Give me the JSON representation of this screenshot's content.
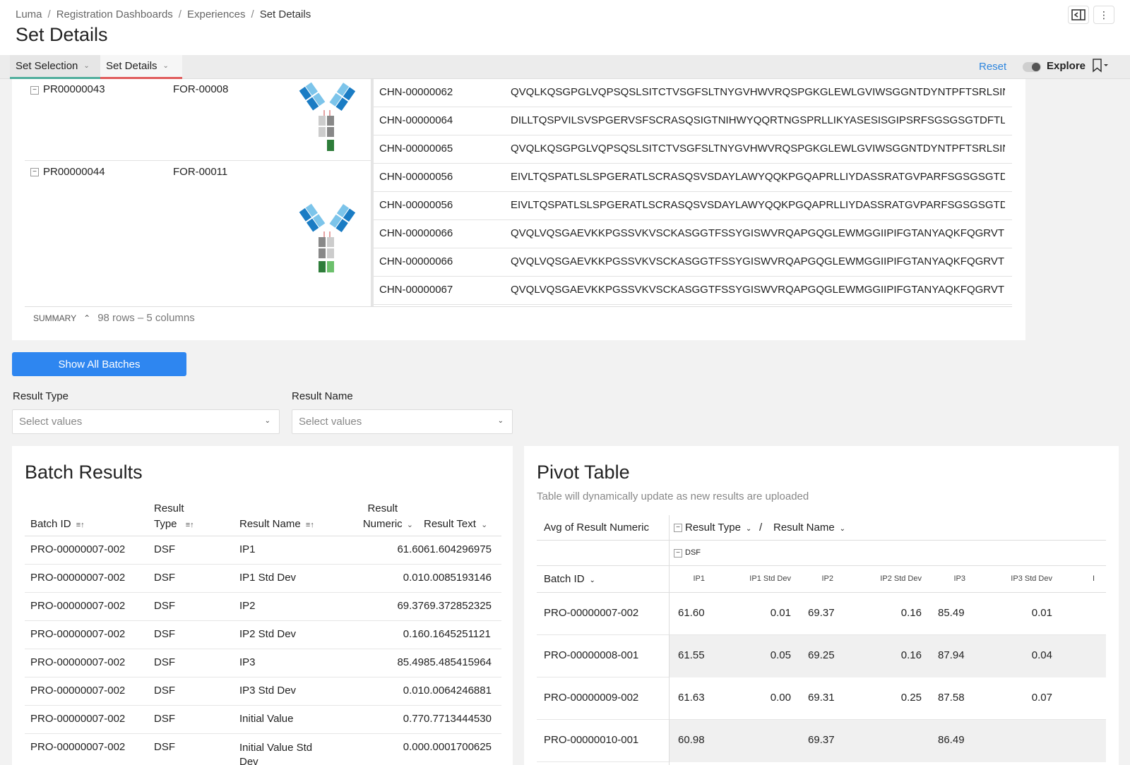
{
  "header": {
    "breadcrumb": [
      "Luma",
      "Registration Dashboards",
      "Experiences",
      "Set Details"
    ],
    "title": "Set Details"
  },
  "tabs": {
    "items": [
      {
        "label": "Set Selection"
      },
      {
        "label": "Set Details"
      }
    ],
    "reset_label": "Reset",
    "explore_label": "Explore"
  },
  "sets_table": {
    "groups": [
      {
        "protein_id": "PR00000043",
        "format": "FOR-00008"
      },
      {
        "protein_id": "PR00000044",
        "format": "FOR-00011"
      }
    ],
    "chains": [
      {
        "id": "CHN-00000062",
        "seq": "QVQLKQSGPGLVQPSQSLSITCTVSGFSLTNYGVHWVRQSPGKGLEWLGVIWSGGNTDYNTPFTSRLSINKD..."
      },
      {
        "id": "CHN-00000064",
        "seq": "DILLTQSPVILSVSPGERVSFSCRASQSIGTNIHWYQQRTNGSPRLLIKYASESISGIPSRFSGSGSGTDFTLSINSV..."
      },
      {
        "id": "CHN-00000065",
        "seq": "QVQLKQSGPGLVQPSQSLSITCTVSGFSLTNYGVHWVRQSPGKGLEWLGVIWSGGNTDYNTPFTSRLSINKD..."
      },
      {
        "id": "CHN-00000056",
        "seq": "EIVLTQSPATLSLSPGERATLSCRASQSVSDAYLAWYQQKPGQAPRLLIYDASSRATGVPARFSGSGSGTDFTLT..."
      },
      {
        "id": "CHN-00000056",
        "seq": "EIVLTQSPATLSLSPGERATLSCRASQSVSDAYLAWYQQKPGQAPRLLIYDASSRATGVPARFSGSGSGTDFTLT..."
      },
      {
        "id": "CHN-00000066",
        "seq": "QVQLVQSGAEVKKPGSSVKVSCKASGGTFSSYGISWVRQAPGQGLEWMGGIIPIFGTANYAQKFQGRVTITAD..."
      },
      {
        "id": "CHN-00000066",
        "seq": "QVQLVQSGAEVKKPGSSVKVSCKASGGTFSSYGISWVRQAPGQGLEWMGGIIPIFGTANYAQKFQGRVTITAD..."
      },
      {
        "id": "CHN-00000067",
        "seq": "QVQLVQSGAEVKKPGSSVKVSCKASGGTFSSYGISWVRQAPGQGLEWMGGIIPIFGTANYAQKFQGRVTITAD..."
      }
    ],
    "summary_label": "SUMMARY",
    "summary_rows": "98 rows – 5 columns"
  },
  "show_all_button": "Show All Batches",
  "filters": {
    "result_type": {
      "label": "Result Type",
      "placeholder": "Select values"
    },
    "result_name": {
      "label": "Result Name",
      "placeholder": "Select values"
    }
  },
  "batch_results": {
    "title": "Batch Results",
    "columns": {
      "batch_id": "Batch ID",
      "result_type_1": "Result",
      "result_type_2": "Type",
      "result_name": "Result Name",
      "result_numeric_1": "Result",
      "result_numeric_2": "Numeric",
      "result_text": "Result Text"
    },
    "rows": [
      {
        "bid": "PRO-00000007-002",
        "rt": "DSF",
        "rn": "IP1",
        "num": "61.60",
        "txt": "61.604296975"
      },
      {
        "bid": "PRO-00000007-002",
        "rt": "DSF",
        "rn": "IP1 Std Dev",
        "num": "0.01",
        "txt": "0.0085193146"
      },
      {
        "bid": "PRO-00000007-002",
        "rt": "DSF",
        "rn": "IP2",
        "num": "69.37",
        "txt": "69.372852325"
      },
      {
        "bid": "PRO-00000007-002",
        "rt": "DSF",
        "rn": "IP2 Std Dev",
        "num": "0.16",
        "txt": "0.1645251121"
      },
      {
        "bid": "PRO-00000007-002",
        "rt": "DSF",
        "rn": "IP3",
        "num": "85.49",
        "txt": "85.485415964"
      },
      {
        "bid": "PRO-00000007-002",
        "rt": "DSF",
        "rn": "IP3 Std Dev",
        "num": "0.01",
        "txt": "0.0064246881"
      },
      {
        "bid": "PRO-00000007-002",
        "rt": "DSF",
        "rn": "Initial Value",
        "num": "0.77",
        "txt": "0.7713444530"
      },
      {
        "bid": "PRO-00000007-002",
        "rt": "DSF",
        "rn": "Initial Value Std Dev",
        "num": "0.00",
        "txt": "0.0001700625"
      }
    ]
  },
  "pivot": {
    "title": "Pivot Table",
    "subtitle": "Table will dynamically update as new results are uploaded",
    "measure": "Avg of Result Numeric",
    "col_dim1": "Result Type",
    "col_sep": "/",
    "col_dim2": "Result Name",
    "group": "DSF",
    "row_dim": "Batch ID",
    "columns": [
      "IP1",
      "IP1 Std Dev",
      "IP2",
      "IP2 Std Dev",
      "IP3",
      "IP3 Std Dev",
      "I"
    ],
    "rows": [
      {
        "bid": "PRO-00000007-002",
        "v": [
          "61.60",
          "0.01",
          "69.37",
          "0.16",
          "85.49",
          "0.01"
        ]
      },
      {
        "bid": "PRO-00000008-001",
        "v": [
          "61.55",
          "0.05",
          "69.25",
          "0.16",
          "87.94",
          "0.04"
        ]
      },
      {
        "bid": "PRO-00000009-002",
        "v": [
          "61.63",
          "0.00",
          "69.31",
          "0.25",
          "87.58",
          "0.07"
        ]
      },
      {
        "bid": "PRO-00000010-001",
        "v": [
          "60.98",
          "",
          "69.37",
          "",
          "86.49",
          ""
        ]
      }
    ]
  }
}
